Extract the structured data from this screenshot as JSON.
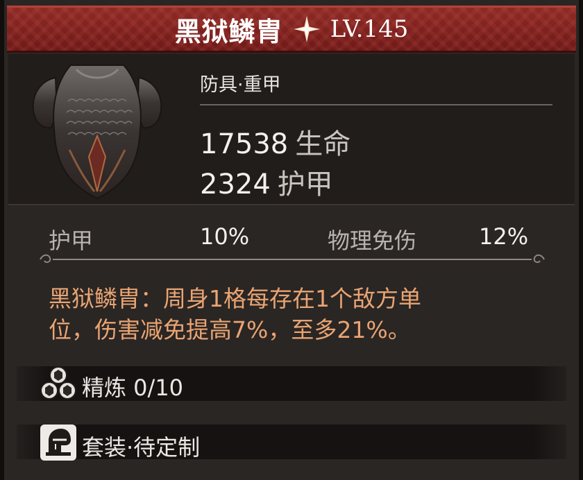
{
  "item": {
    "name": "黑狱鳞胄",
    "level": "LV.145",
    "type": "防具·重甲"
  },
  "stats": [
    {
      "value": "17538",
      "label": "生命"
    },
    {
      "value": "2324",
      "label": "护甲"
    }
  ],
  "resistances": [
    {
      "label": "护甲",
      "value": "10%"
    },
    {
      "label": "物理免伤",
      "value": "12%"
    }
  ],
  "effect": {
    "line1": "黑狱鳞胄：周身1格每存在1个敌方单",
    "line2": "位，伤害减免提高7%，至多21%。"
  },
  "refine": {
    "label": "精炼 0/10"
  },
  "set": {
    "label": "套装·待定制"
  },
  "colors": {
    "title_bar": "#7c201d",
    "effect_text": "#e9a472",
    "panel_bg": "#2a2624"
  },
  "icons": [
    "star-rarity-icon",
    "armor-item-icon",
    "refine-icon",
    "set-helmet-icon"
  ]
}
